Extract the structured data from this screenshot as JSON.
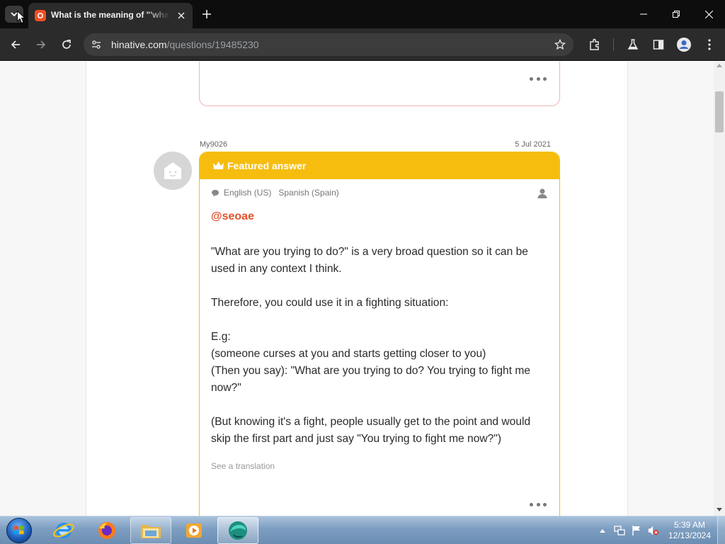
{
  "browser": {
    "tab": {
      "title": "What is the meaning of \"'what"
    },
    "address": {
      "host": "hinative.com",
      "path": "/questions/19485230"
    }
  },
  "answer": {
    "username": "My9026",
    "date": "5 Jul 2021",
    "featured_label": "Featured answer",
    "languages": [
      "English (US)",
      "Spanish (Spain)"
    ],
    "mention": "@seoae",
    "paragraphs": [
      [
        "\"What are you trying to do?\" is a very broad question so it can be used in any context I think."
      ],
      [
        "Therefore, you could use it in a fighting situation:"
      ],
      [
        "E.g:",
        "(someone curses at you and starts getting closer to you)",
        "(Then you say): \"What are you trying to do? You trying to fight me now?\""
      ],
      [
        "(But knowing it's a fight, people usually get to the point and would skip the first part and just say \"You trying to fight me now?\")"
      ]
    ],
    "see_translation": "See a translation"
  },
  "taskbar": {
    "clock": {
      "time": "5:39 AM",
      "date": "12/13/2024"
    },
    "apps": [
      "internet-explorer",
      "firefox",
      "file-explorer",
      "media-player",
      "browser-active"
    ]
  },
  "colors": {
    "featured": "#f6bd0f",
    "mention": "#e0522a",
    "brand": "#f04e23"
  }
}
